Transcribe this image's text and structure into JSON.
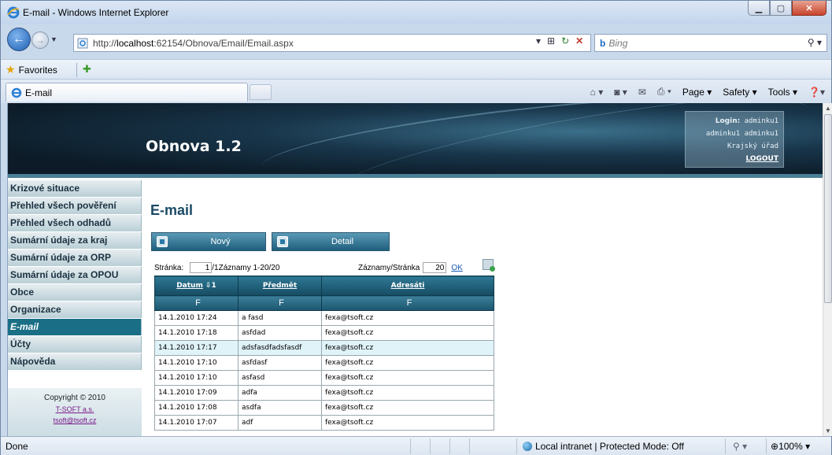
{
  "browser": {
    "window_title": "E-mail - Windows Internet Explorer",
    "url_prefix": "http://",
    "url_host": "localhost",
    "url_rest": ":62154/Obnova/Email/Email.aspx",
    "search_placeholder": "Bing",
    "search_brand": "b",
    "favorites_label": "Favorites",
    "tab_label": "E-mail",
    "commands": [
      "Page ▾",
      "Safety ▾",
      "Tools ▾"
    ],
    "status_text": "Done",
    "zone_text": "Local intranet | Protected Mode: Off",
    "zoom_text": "100%"
  },
  "header": {
    "site_title": "Obnova 1.2",
    "login_label": "Login:",
    "login_user": "adminku1",
    "user_full_name": "adminku1 adminku1",
    "organization": "Krajský úřad",
    "logout_label": "LOGOUT"
  },
  "menu": {
    "items": [
      {
        "label": "Krizové situace"
      },
      {
        "label": "Přehled všech pověření"
      },
      {
        "label": "Přehled všech odhadů"
      },
      {
        "label": "Sumární údaje za kraj"
      },
      {
        "label": "Sumární údaje za ORP"
      },
      {
        "label": "Sumární údaje za OPOU"
      },
      {
        "label": "Obce"
      },
      {
        "label": "Organizace"
      },
      {
        "label": "E-mail",
        "active": true
      },
      {
        "label": "Účty"
      },
      {
        "label": "Nápověda"
      }
    ],
    "copyright": "Copyright © 2010",
    "company_link": "T-SOFT a.s.",
    "email_link": "tsoft@tsoft.cz"
  },
  "main": {
    "page_title": "E-mail",
    "btn_new": "Nový",
    "btn_detail": "Detail",
    "pager_label": "Stránka:",
    "pager_value": "1",
    "pager_info": "/1Záznamy 1-20/20",
    "page_size_label": "Záznamy/Stránka",
    "page_size_value": "20",
    "page_size_ok": "OK",
    "columns": [
      "Datum",
      "Předmět",
      "Adresáti"
    ],
    "sort_indicator": "⇩1",
    "filter_label": "F",
    "rows": [
      {
        "date": "14.1.2010 17:24",
        "subject": "a fasd",
        "to": "fexa@tsoft.cz"
      },
      {
        "date": "14.1.2010 17:18",
        "subject": "asfdad",
        "to": "fexa@tsoft.cz"
      },
      {
        "date": "14.1.2010 17:17",
        "subject": "adsfasdfadsfasdf",
        "to": "fexa@tsoft.cz"
      },
      {
        "date": "14.1.2010 17:10",
        "subject": "asfdasf",
        "to": "fexa@tsoft.cz"
      },
      {
        "date": "14.1.2010 17:10",
        "subject": "asfasd",
        "to": "fexa@tsoft.cz"
      },
      {
        "date": "14.1.2010 17:09",
        "subject": "adfa",
        "to": "fexa@tsoft.cz"
      },
      {
        "date": "14.1.2010 17:08",
        "subject": "asdfa",
        "to": "fexa@tsoft.cz"
      },
      {
        "date": "14.1.2010 17:07",
        "subject": "adf",
        "to": "fexa@tsoft.cz"
      }
    ]
  }
}
